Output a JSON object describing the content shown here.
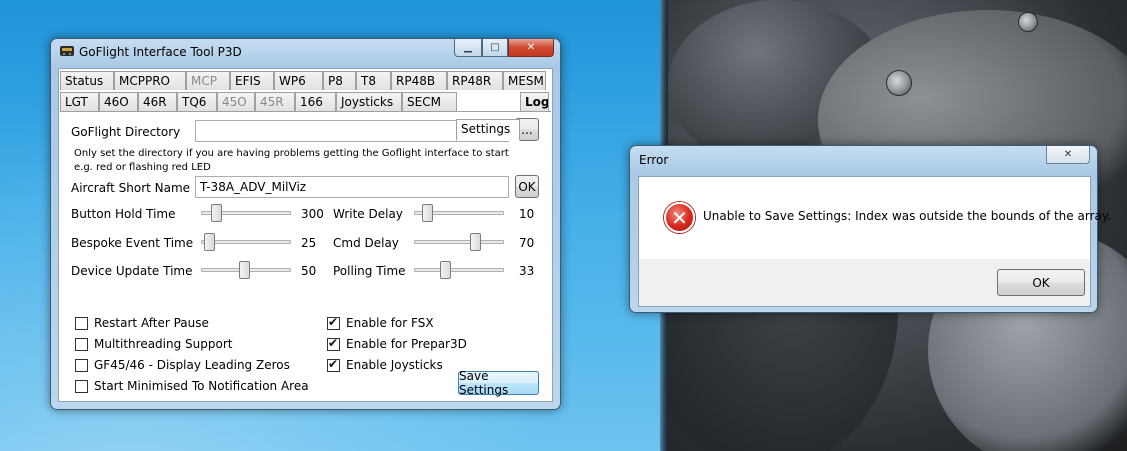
{
  "main_window": {
    "title": "GoFlight Interface Tool P3D",
    "tabs_row1": [
      {
        "label": "Status",
        "disabled": false
      },
      {
        "label": "MCPPRO",
        "disabled": false
      },
      {
        "label": "MCP",
        "disabled": true
      },
      {
        "label": "EFIS",
        "disabled": false
      },
      {
        "label": "WP6",
        "disabled": false
      },
      {
        "label": "P8",
        "disabled": false
      },
      {
        "label": "T8",
        "disabled": false
      },
      {
        "label": "RP48B",
        "disabled": false
      },
      {
        "label": "RP48R",
        "disabled": false
      },
      {
        "label": "MESM",
        "disabled": false
      }
    ],
    "tabs_row2": [
      {
        "label": "LGT",
        "disabled": false
      },
      {
        "label": "46O",
        "disabled": false
      },
      {
        "label": "46R",
        "disabled": false
      },
      {
        "label": "TQ6",
        "disabled": false
      },
      {
        "label": "45O",
        "disabled": true
      },
      {
        "label": "45R",
        "disabled": true
      },
      {
        "label": "166",
        "disabled": false
      },
      {
        "label": "Joysticks",
        "disabled": false
      },
      {
        "label": "SECM",
        "disabled": false
      },
      {
        "label": "Settings",
        "disabled": false,
        "active": true
      },
      {
        "label": "Log",
        "disabled": false,
        "bold": true
      }
    ],
    "settings": {
      "goflight_dir_label": "GoFlight Directory",
      "goflight_dir_value": "",
      "browse_label": "...",
      "dir_hint": "Only set the directory if you are having problems getting the Goflight interface to start e.g. red or flashing red LED",
      "aircraft_label": "Aircraft Short Name",
      "aircraft_value": "T-38A_ADV_MilViz",
      "ok_label": "OK",
      "sliders": [
        {
          "label": "Button Hold Time",
          "value": "300",
          "level": 0.12
        },
        {
          "label": "Bespoke Event Time",
          "value": "25",
          "level": 0.04
        },
        {
          "label": "Device Update Time",
          "value": "50",
          "level": 0.48
        },
        {
          "label": "Write Delay",
          "value": "10",
          "level": 0.1
        },
        {
          "label": "Cmd Delay",
          "value": "70",
          "level": 0.7
        },
        {
          "label": "Polling Time",
          "value": "33",
          "level": 0.33
        }
      ],
      "checkboxes_left": [
        {
          "label": "Restart After Pause",
          "checked": false
        },
        {
          "label": "Multithreading Support",
          "checked": false
        },
        {
          "label": "GF45/46 - Display Leading Zeros",
          "checked": false
        },
        {
          "label": "Start Minimised To Notification Area",
          "checked": false
        }
      ],
      "checkboxes_right": [
        {
          "label": "Enable for FSX",
          "checked": true
        },
        {
          "label": "Enable for Prepar3D",
          "checked": true
        },
        {
          "label": "Enable Joysticks",
          "checked": true
        }
      ],
      "save_label": "Save Settings"
    }
  },
  "error_dialog": {
    "title": "Error",
    "message": "Unable to Save Settings: Index was outside the bounds of the array.",
    "ok_label": "OK",
    "icon": "error-icon"
  },
  "colors": {
    "desktop_blue": "#2a9be0",
    "error_red": "#d9261c"
  }
}
